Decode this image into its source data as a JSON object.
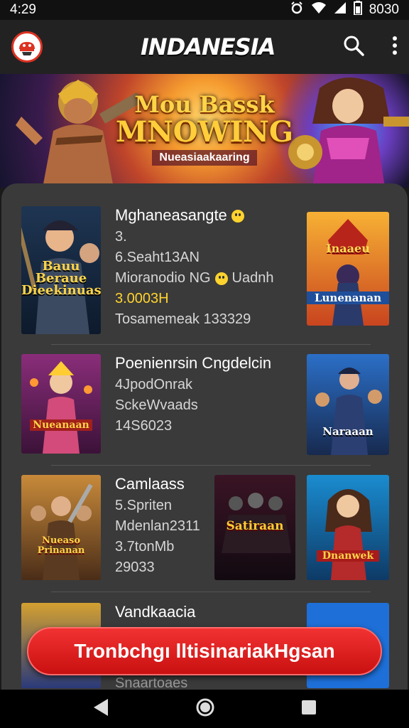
{
  "status": {
    "time": "4:29",
    "battery": "8030"
  },
  "app": {
    "title": "INDANESIA"
  },
  "banner": {
    "line1": "Mou Bassk",
    "line2": "MNOWING",
    "line3": "Nueasiaakaaring"
  },
  "items": [
    {
      "title": "Mghaneasangte",
      "lines": [
        "3.",
        "6.Seaht13AN",
        "Mioranodio NG",
        "3.0003H",
        "Tosamemeak 133329"
      ],
      "line3_extra": "Uadnh",
      "thumb_left": "Bauu Beraue Dieekinuas",
      "thumb_right_top": "Inaaeu",
      "thumb_right_bottom": "Lunenanan"
    },
    {
      "title": "Poenienrsin Cngdelcin",
      "lines": [
        "4JpodOnrak",
        "SckeWvaads",
        "14S6023"
      ],
      "thumb_left": "Nueanaan",
      "thumb_right": "Naraaan"
    },
    {
      "title": "Camlaass",
      "lines": [
        "5.Spriten",
        "Mdenlan2311",
        "3.7tonMb",
        "29033"
      ],
      "thumb_left": "Nueaso Prinanan",
      "thumb_mid": "Satiraan",
      "thumb_right": "Dnanwek"
    },
    {
      "title": "Vandkaacia",
      "lines": [
        "Snaartoaes"
      ]
    }
  ],
  "cta": {
    "label": "Tronbchgı lltisinariakHgsan"
  },
  "colors": {
    "accent": "#e61d1d",
    "highlight": "#ffd32e",
    "panel": "#3a3a3a"
  },
  "icons": [
    "logo-icon",
    "search-icon",
    "more-vert-icon",
    "alarm-icon",
    "wifi-icon",
    "signal-icon",
    "battery-icon",
    "back-icon",
    "home-icon",
    "recents-icon",
    "emoji-icon"
  ]
}
